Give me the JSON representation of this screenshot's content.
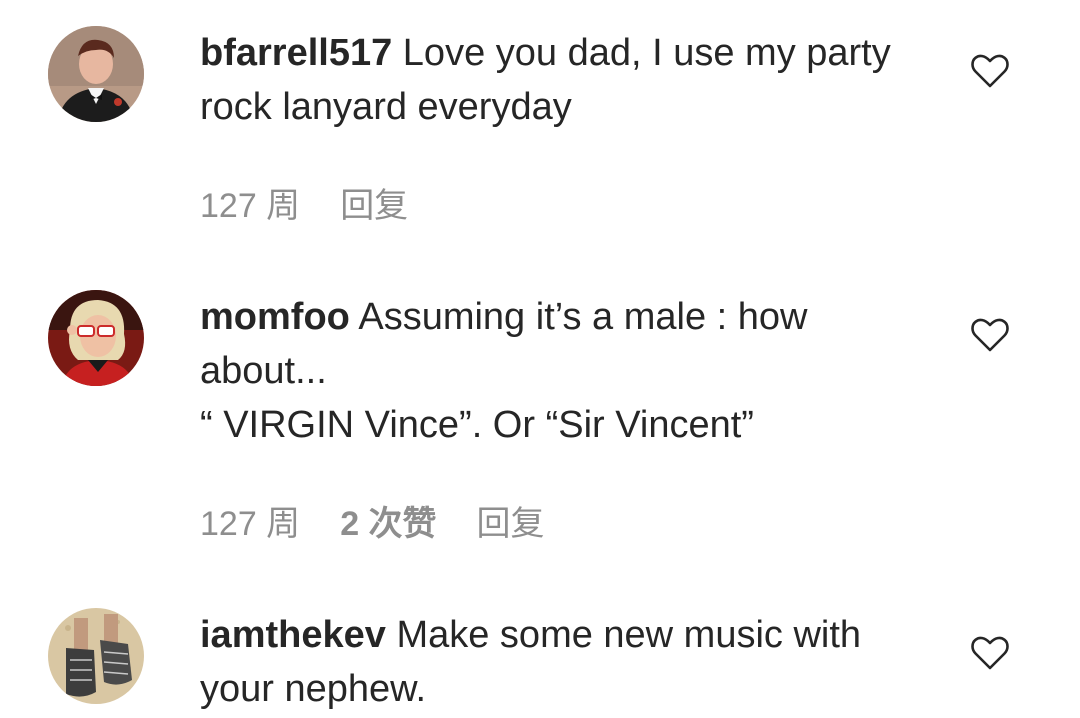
{
  "comments": [
    {
      "username": "bfarrell517",
      "text": "Love you dad, I use my party rock lanyard everyday",
      "time": "127 周",
      "likes": "",
      "reply_label": "回复"
    },
    {
      "username": "momfoo",
      "text": "Assuming it’s a male : how about...\n“ VIRGIN Vince”. Or “Sir Vincent”",
      "time": "127 周",
      "likes": "2 次赞",
      "reply_label": "回复"
    },
    {
      "username": "iamthekev",
      "text": "Make some new music with your nephew.",
      "time": "",
      "likes": "",
      "reply_label": ""
    }
  ],
  "icons": {
    "like": "heart-outline-icon"
  },
  "colors": {
    "text": "#262626",
    "meta": "#8e8e8e",
    "background": "#ffffff"
  }
}
